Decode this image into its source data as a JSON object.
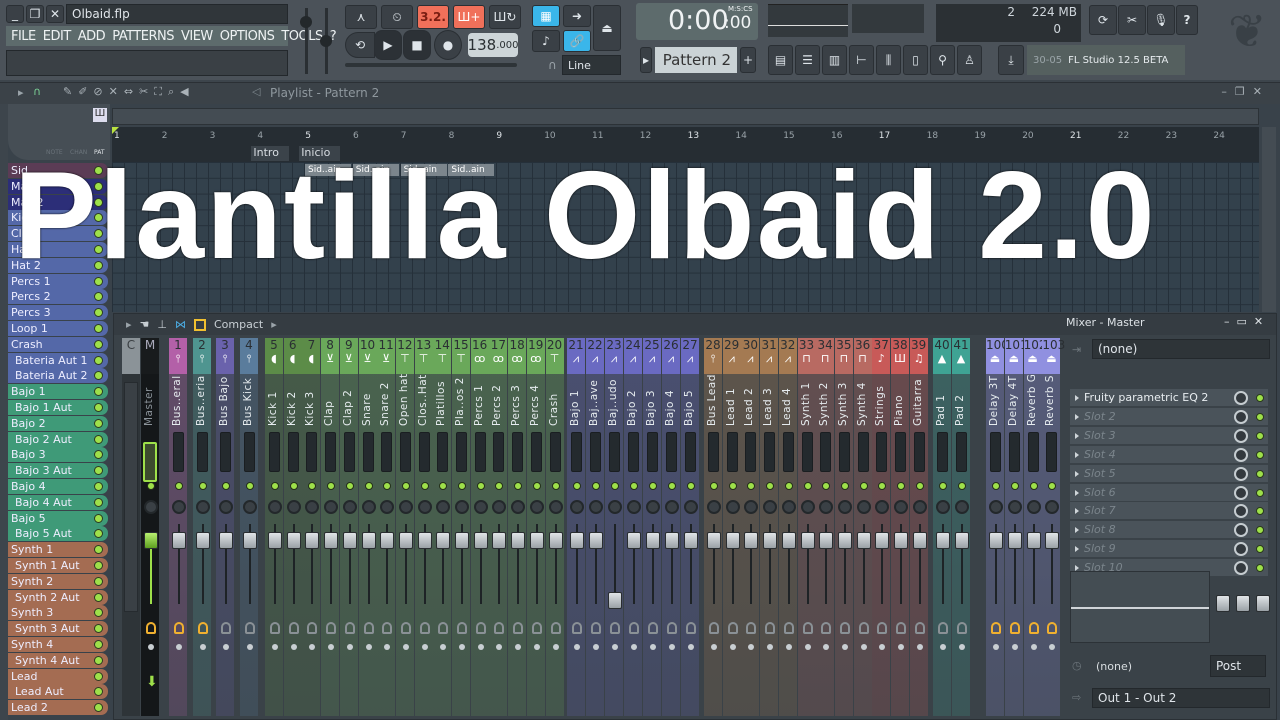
{
  "window": {
    "filename": "Olbaid.flp"
  },
  "menu": [
    "FILE",
    "EDIT",
    "ADD",
    "PATTERNS",
    "VIEW",
    "OPTIONS",
    "TOOLS",
    "?"
  ],
  "transport": {
    "tempo": "138",
    "tempo_decimals": ".000",
    "time": "0:00",
    "time_cs": ":00",
    "time_format": "M:S:CS",
    "snap": "Line",
    "pattern": "Pattern 2",
    "countdown_label": "3.2.",
    "plus": "+"
  },
  "monitor": {
    "cpu": "2",
    "memory": "224 MB",
    "polyphony": "0"
  },
  "hint": {
    "code": "30-05",
    "text": "FL Studio 12.5 BETA"
  },
  "playlist": {
    "title": "Playlist - Pattern 2",
    "mode_labels": [
      "NOTE",
      "CHAN",
      "PAT"
    ],
    "bars": [
      "1",
      "2",
      "3",
      "4",
      "5",
      "6",
      "7",
      "8",
      "9",
      "10",
      "11",
      "12",
      "13",
      "14",
      "15",
      "16",
      "17",
      "18",
      "19",
      "20",
      "21",
      "22",
      "23",
      "24"
    ],
    "markers": [
      {
        "label": "Intro",
        "bar": 4
      },
      {
        "label": "Inicio",
        "bar": 5
      }
    ],
    "clips": [
      {
        "label": "Sid..ain",
        "bar": 5
      },
      {
        "label": "Sid..ain",
        "bar": 6
      },
      {
        "label": "Sid..ain",
        "bar": 7
      },
      {
        "label": "Sid..ain",
        "bar": 8
      }
    ],
    "patterns": [
      {
        "label": "Sid",
        "color": "#5b3c55",
        "sub": false
      },
      {
        "label": "Mas",
        "color": "#2c2e78",
        "sub": false
      },
      {
        "label": "Mas 2",
        "color": "#2c2e78",
        "sub": false
      },
      {
        "label": "Kic",
        "color": "#5468a8",
        "sub": false
      },
      {
        "label": "Cla",
        "color": "#5468a8",
        "sub": false
      },
      {
        "label": "Hat",
        "color": "#5468a8",
        "sub": false
      },
      {
        "label": "Hat 2",
        "color": "#5468a8",
        "sub": false
      },
      {
        "label": "Percs 1",
        "color": "#5468a8",
        "sub": false
      },
      {
        "label": "Percs 2",
        "color": "#5468a8",
        "sub": false
      },
      {
        "label": "Percs 3",
        "color": "#5468a8",
        "sub": false
      },
      {
        "label": "Loop 1",
        "color": "#5468a8",
        "sub": false
      },
      {
        "label": "Crash",
        "color": "#5468a8",
        "sub": false
      },
      {
        "label": "Bateria Aut 1",
        "color": "#5468a8",
        "sub": true
      },
      {
        "label": "Bateria Aut 2",
        "color": "#5468a8",
        "sub": true
      },
      {
        "label": "Bajo 1",
        "color": "#3f9a78",
        "sub": false
      },
      {
        "label": "Bajo 1 Aut",
        "color": "#3f9a78",
        "sub": true
      },
      {
        "label": "Bajo 2",
        "color": "#3f9a78",
        "sub": false
      },
      {
        "label": "Bajo 2 Aut",
        "color": "#3f9a78",
        "sub": true
      },
      {
        "label": "Bajo 3",
        "color": "#3f9a78",
        "sub": false
      },
      {
        "label": "Bajo 3 Aut",
        "color": "#3f9a78",
        "sub": true
      },
      {
        "label": "Bajo 4",
        "color": "#3f9a78",
        "sub": false
      },
      {
        "label": "Bajo 4 Aut",
        "color": "#3f9a78",
        "sub": true
      },
      {
        "label": "Bajo 5",
        "color": "#3f9a78",
        "sub": false
      },
      {
        "label": "Bajo 5 Aut",
        "color": "#3f9a78",
        "sub": true
      },
      {
        "label": "Synth 1",
        "color": "#a46c52",
        "sub": false
      },
      {
        "label": "Synth 1 Aut",
        "color": "#a46c52",
        "sub": true
      },
      {
        "label": "Synth 2",
        "color": "#a46c52",
        "sub": false
      },
      {
        "label": "Synth 2 Aut",
        "color": "#a46c52",
        "sub": true
      },
      {
        "label": "Synth 3",
        "color": "#a46c52",
        "sub": false
      },
      {
        "label": "Synth 3 Aut",
        "color": "#a46c52",
        "sub": true
      },
      {
        "label": "Synth 4",
        "color": "#a46c52",
        "sub": false
      },
      {
        "label": "Synth 4 Aut",
        "color": "#a46c52",
        "sub": true
      },
      {
        "label": "Lead",
        "color": "#a46c52",
        "sub": false
      },
      {
        "label": "Lead Aut",
        "color": "#a46c52",
        "sub": true
      },
      {
        "label": "Lead 2",
        "color": "#a46c52",
        "sub": false
      }
    ]
  },
  "overlay_title": "Plantilla Olbaid 2.0",
  "mixer": {
    "view_label": "Compact",
    "current_label": "C",
    "master": {
      "number": "M",
      "label": "Master"
    },
    "inserts": [
      {
        "n": "1",
        "label": "Bus..eral",
        "color": "#b360a8",
        "icon": "bus-icon",
        "route": true
      },
      {
        "n": "2",
        "label": "Bus..eria",
        "color": "#4f9590",
        "icon": "bus-icon",
        "route": true
      },
      {
        "n": "3",
        "label": "Bus Bajo",
        "color": "#6a62ac",
        "icon": "bus-icon",
        "route": false
      },
      {
        "n": "4",
        "label": "Bus Kick",
        "color": "#5a7c9c",
        "icon": "bus-icon",
        "route": false
      },
      {
        "n": "5",
        "label": "Kick 1",
        "color": "#5c8c48",
        "icon": "kick-drum-icon",
        "route": false
      },
      {
        "n": "6",
        "label": "Kick 2",
        "color": "#5c8c48",
        "icon": "kick-drum-icon",
        "route": false
      },
      {
        "n": "7",
        "label": "Kick 3",
        "color": "#5c8c48",
        "icon": "kick-drum-icon",
        "route": false
      },
      {
        "n": "8",
        "label": "Clap",
        "color": "#6aa85a",
        "icon": "snare-drum-icon",
        "route": false
      },
      {
        "n": "9",
        "label": "Clap 2",
        "color": "#6aa85a",
        "icon": "snare-drum-icon",
        "route": false
      },
      {
        "n": "10",
        "label": "Snare",
        "color": "#6aa85a",
        "icon": "snare-drum-icon",
        "route": false
      },
      {
        "n": "11",
        "label": "Snare 2",
        "color": "#6aa85a",
        "icon": "snare-drum-icon",
        "route": false
      },
      {
        "n": "12",
        "label": "Open hat",
        "color": "#6aa85a",
        "icon": "cymbal-icon",
        "route": false
      },
      {
        "n": "13",
        "label": "Clos..Hat",
        "color": "#6aa85a",
        "icon": "cymbal-icon",
        "route": false
      },
      {
        "n": "14",
        "label": "Platillos",
        "color": "#6aa85a",
        "icon": "cymbal-icon",
        "route": false
      },
      {
        "n": "15",
        "label": "Pla..os 2",
        "color": "#6aa85a",
        "icon": "cymbal-icon",
        "route": false
      },
      {
        "n": "16",
        "label": "Percs 1",
        "color": "#6aa85a",
        "icon": "percussion-icon",
        "route": false
      },
      {
        "n": "17",
        "label": "Percs 2",
        "color": "#6aa85a",
        "icon": "percussion-icon",
        "route": false
      },
      {
        "n": "18",
        "label": "Percs 3",
        "color": "#6aa85a",
        "icon": "percussion-icon",
        "route": false
      },
      {
        "n": "19",
        "label": "Percs 4",
        "color": "#6aa85a",
        "icon": "percussion-icon",
        "route": false
      },
      {
        "n": "20",
        "label": "Crash",
        "color": "#6aa85a",
        "icon": "cymbal-icon",
        "route": false
      },
      {
        "n": "21",
        "label": "Bajo 1",
        "color": "#6a6ac2",
        "icon": "sawtooth-wave-icon",
        "route": false
      },
      {
        "n": "22",
        "label": "Baj..ave",
        "color": "#6a6ac2",
        "icon": "sawtooth-wave-icon",
        "route": false
      },
      {
        "n": "23",
        "label": "Baj..udo",
        "color": "#6a6ac2",
        "icon": "sawtooth-wave-icon",
        "route": false
      },
      {
        "n": "24",
        "label": "Bajo 2",
        "color": "#6a6ac2",
        "icon": "sawtooth-wave-icon",
        "route": false
      },
      {
        "n": "25",
        "label": "Bajo 3",
        "color": "#6a6ac2",
        "icon": "sawtooth-wave-icon",
        "route": false
      },
      {
        "n": "26",
        "label": "Bajo 4",
        "color": "#6a6ac2",
        "icon": "sawtooth-wave-icon",
        "route": false
      },
      {
        "n": "27",
        "label": "Bajo 5",
        "color": "#6a6ac2",
        "icon": "sawtooth-wave-icon",
        "route": false
      },
      {
        "n": "28",
        "label": "Bus Lead",
        "color": "#a47a52",
        "icon": "bus-icon",
        "route": false
      },
      {
        "n": "29",
        "label": "Lead 1",
        "color": "#a47a52",
        "icon": "sawtooth-wave-icon",
        "route": false
      },
      {
        "n": "30",
        "label": "Lead 2",
        "color": "#a47a52",
        "icon": "sawtooth-wave-icon",
        "route": false
      },
      {
        "n": "31",
        "label": "Lead 3",
        "color": "#a47a52",
        "icon": "sawtooth-wave-icon",
        "route": false
      },
      {
        "n": "32",
        "label": "Lead 4",
        "color": "#a47a52",
        "icon": "sawtooth-wave-icon",
        "route": false
      },
      {
        "n": "33",
        "label": "Synth 1",
        "color": "#b86a62",
        "icon": "square-wave-icon",
        "route": false
      },
      {
        "n": "34",
        "label": "Synth 2",
        "color": "#b86a62",
        "icon": "square-wave-icon",
        "route": false
      },
      {
        "n": "35",
        "label": "Synth 3",
        "color": "#b86a62",
        "icon": "square-wave-icon",
        "route": false
      },
      {
        "n": "36",
        "label": "Synth 4",
        "color": "#b86a62",
        "icon": "square-wave-icon",
        "route": false
      },
      {
        "n": "37",
        "label": "Strings",
        "color": "#c85a58",
        "icon": "violin-icon",
        "route": false
      },
      {
        "n": "38",
        "label": "Piano",
        "color": "#c85a58",
        "icon": "piano-icon",
        "route": false
      },
      {
        "n": "39",
        "label": "Guitarra",
        "color": "#c85a58",
        "icon": "guitar-icon",
        "route": false
      },
      {
        "n": "40",
        "label": "Pad 1",
        "color": "#3fa394",
        "icon": "pad-wave-icon",
        "route": false
      },
      {
        "n": "41",
        "label": "Pad 2",
        "color": "#3fa394",
        "icon": "pad-wave-icon",
        "route": false
      },
      {
        "n": "100",
        "label": "Delay 3T",
        "color": "#9090e0",
        "icon": "effect-icon",
        "route": true
      },
      {
        "n": "101",
        "label": "Delay 4T",
        "color": "#9090e0",
        "icon": "effect-icon",
        "route": true
      },
      {
        "n": "102",
        "label": "Reverb G",
        "color": "#9090e0",
        "icon": "effect-icon",
        "route": true
      },
      {
        "n": "103",
        "label": "Reverb S",
        "color": "#9090e0",
        "icon": "effect-icon",
        "route": true
      }
    ],
    "panel": {
      "title": "Mixer - Master",
      "input": "(none)",
      "slots": [
        "Fruity parametric EQ 2",
        "Slot 2",
        "Slot 3",
        "Slot 4",
        "Slot 5",
        "Slot 6",
        "Slot 7",
        "Slot 8",
        "Slot 9",
        "Slot 10"
      ],
      "sidechain": "(none)",
      "post_label": "Post",
      "output": "Out 1 - Out 2"
    }
  }
}
